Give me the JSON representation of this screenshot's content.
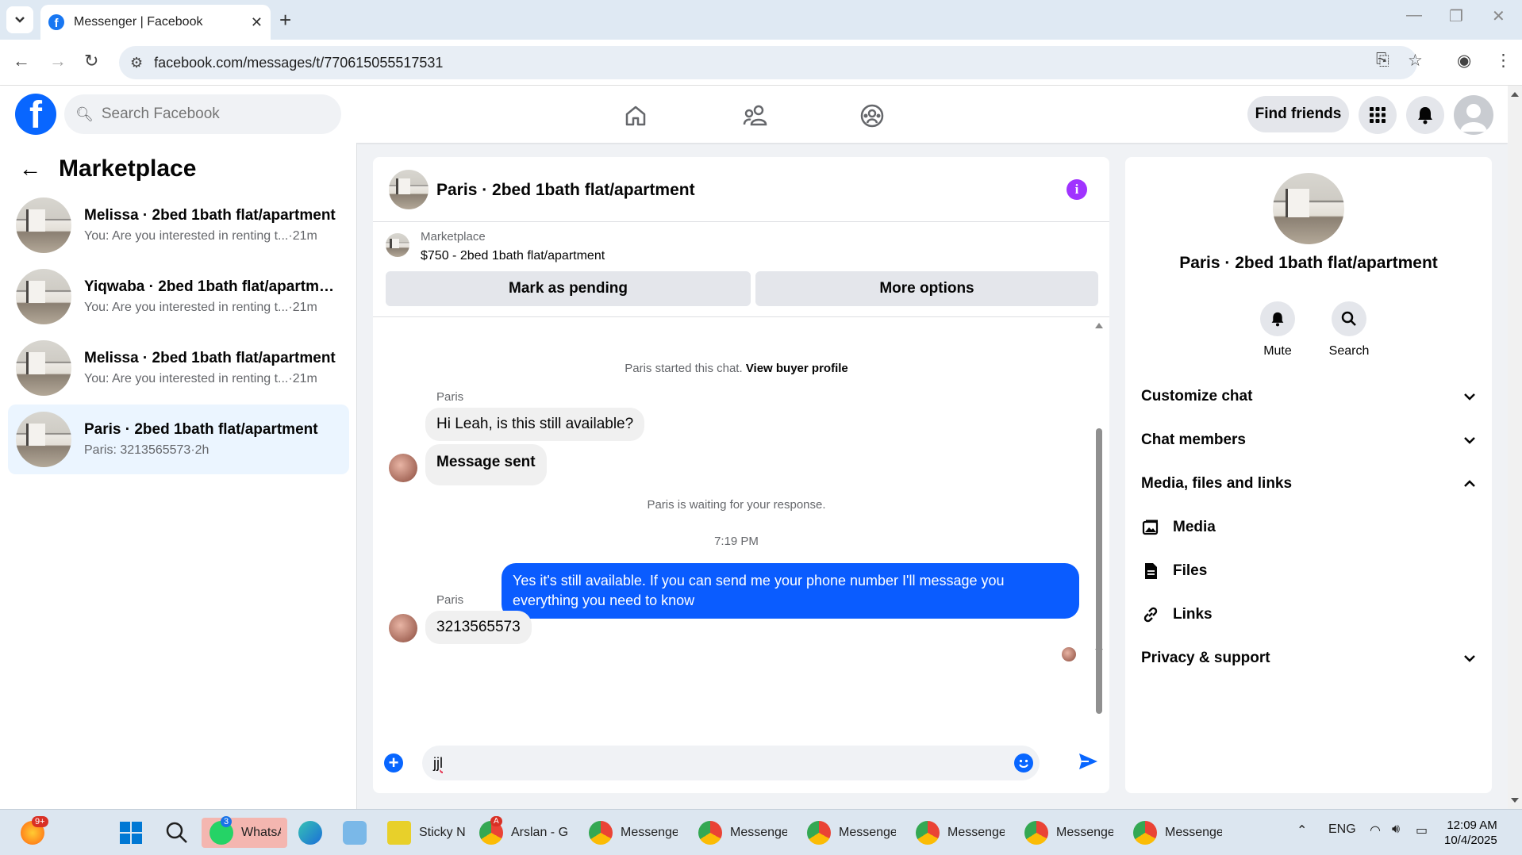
{
  "browser": {
    "tab_title": "Messenger | Facebook",
    "url": "facebook.com/messages/t/770615055517531"
  },
  "fb": {
    "search_placeholder": "Search Facebook",
    "find_friends": "Find friends"
  },
  "left": {
    "header": "Marketplace",
    "conversations": [
      {
        "name": "Melissa · 2bed 1bath flat/apartment",
        "preview": "You: Are you interested in renting t...",
        "time": "·21m"
      },
      {
        "name": "Yiqwaba · 2bed 1bath flat/apartme...",
        "preview": "You: Are you interested in renting t...",
        "time": "·21m"
      },
      {
        "name": "Melissa · 2bed 1bath flat/apartment",
        "preview": "You: Are you interested in renting t...",
        "time": "·21m"
      },
      {
        "name": "Paris · 2bed 1bath flat/apartment",
        "preview": "Paris: 3213565573",
        "time": "·2h"
      }
    ]
  },
  "chat": {
    "title": "Paris · 2bed 1bath flat/apartment",
    "marketplace_label": "Marketplace",
    "listing": "$750 - 2bed 1bath flat/apartment",
    "mark_pending": "Mark as pending",
    "more_options": "More options",
    "started_text": "Paris started this chat.",
    "view_profile": "View buyer profile",
    "sender1": "Paris",
    "msg1": "Hi Leah, is this still available?",
    "msg2": "Message sent",
    "waiting": "Paris is waiting for your response.",
    "time": "7:19 PM",
    "reply": "Yes it's still available. If you can send me your phone number I'll message you everything you need to know",
    "sender2": "Paris",
    "msg3": "3213565573",
    "composer_text": "jjl"
  },
  "right": {
    "title": "Paris · 2bed 1bath flat/apartment",
    "mute": "Mute",
    "search": "Search",
    "customize": "Customize chat",
    "members": "Chat members",
    "media_files": "Media, files and links",
    "media": "Media",
    "files": "Files",
    "links": "Links",
    "privacy": "Privacy & support"
  },
  "taskbar": {
    "badge_notif": "9+",
    "whatsapp": "WhatsA",
    "whatsapp_badge": "3",
    "sticky": "Sticky N",
    "arslan": "Arslan - Gc",
    "arslan_badge": "A",
    "messenger": "Messenger",
    "lang": "ENG",
    "time": "12:09 AM",
    "date": "10/4/2025"
  },
  "colors": {
    "fb_blue": "#0866ff",
    "outgoing_bubble": "#0a5cff",
    "info_purple": "#a033ff",
    "active_row": "#ebf5ff"
  }
}
